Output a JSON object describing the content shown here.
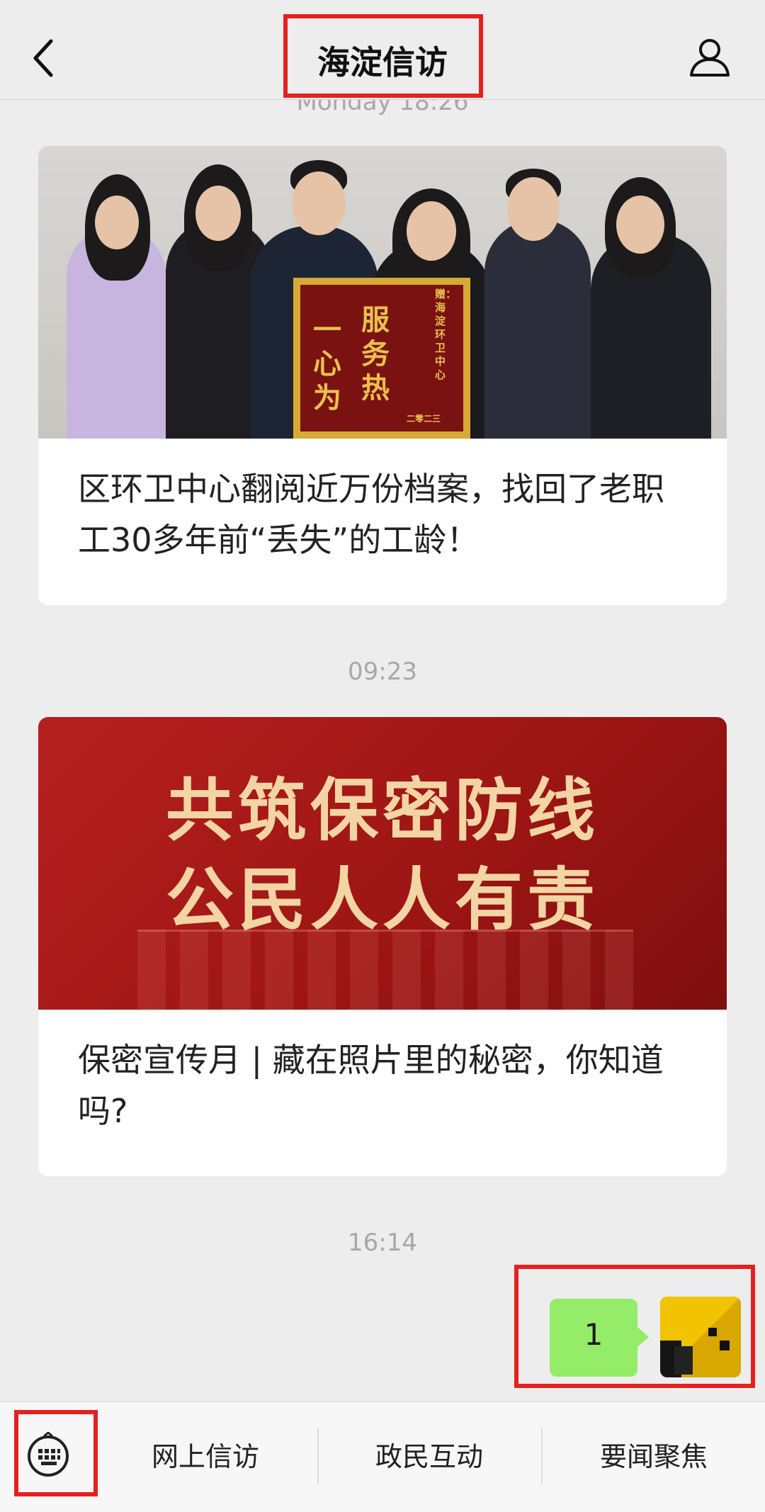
{
  "header": {
    "title": "海淀信访",
    "partial_timestamp": "Monday 18:26"
  },
  "articles": [
    {
      "caption": "区环卫中心翻阅近万份档案，找回了老职工30多年前“丢失”的工龄！",
      "image_text": {
        "banner_right": "赠：海淀环卫中心",
        "banner_col1": "服务热",
        "banner_col2": "一心为",
        "banner_bottom": "二零二三"
      }
    },
    {
      "time": "09:23",
      "caption": "保密宣传月 | 藏在照片里的秘密，你知道吗?",
      "image_text": {
        "line1": "共筑保密防线",
        "line2": "公民人人有责"
      }
    }
  ],
  "message": {
    "time": "16:14",
    "text": "1",
    "bubble_color": "#95ec69"
  },
  "bottom_menu": {
    "items": [
      "网上信访",
      "政民互动",
      "要闻聚焦"
    ]
  },
  "colors": {
    "highlight": "#e5211f",
    "background": "#ededed",
    "banner_red": "#b6201e"
  },
  "icons": {
    "back": "back-arrow-icon",
    "profile": "profile-icon",
    "keyboard": "keyboard-icon"
  }
}
